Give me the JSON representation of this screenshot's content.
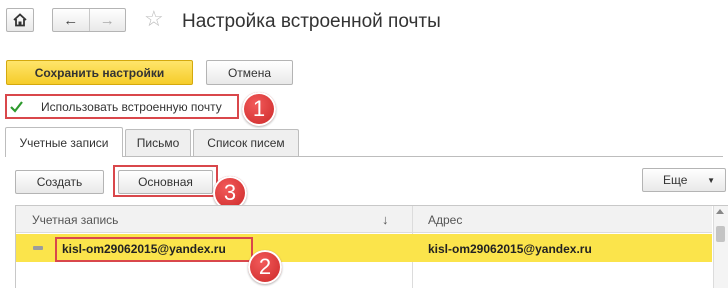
{
  "toolbar": {
    "home_icon": "home-icon",
    "back_icon": "arrow-left-icon",
    "forward_icon": "arrow-right-icon",
    "favorite_icon": "star-icon",
    "title": "Настройка встроенной почты"
  },
  "actions": {
    "save_label": "Сохранить настройки",
    "cancel_label": "Отмена"
  },
  "use_builtin_mail": {
    "label": "Использовать встроенную почту",
    "checked": true
  },
  "tabs": [
    {
      "label": "Учетные записи",
      "active": true
    },
    {
      "label": "Письмо",
      "active": false
    },
    {
      "label": "Список писем",
      "active": false
    }
  ],
  "list_toolbar": {
    "create_label": "Создать",
    "main_label": "Основная",
    "more_label": "Еще"
  },
  "table": {
    "columns": [
      "Учетная запись",
      "Адрес"
    ],
    "sort_indicator": "↓",
    "rows": [
      {
        "marker": "—",
        "account": "kisl-om29062015@yandex.ru",
        "address": "kisl-om29062015@yandex.ru",
        "selected": true
      }
    ]
  },
  "annotations": [
    "1",
    "2",
    "3"
  ],
  "colors": {
    "accent_yellow": "#f5cc2a",
    "selected_row": "#fbe44b",
    "highlight_border": "#d9474b",
    "badge_red": "#d83030"
  }
}
